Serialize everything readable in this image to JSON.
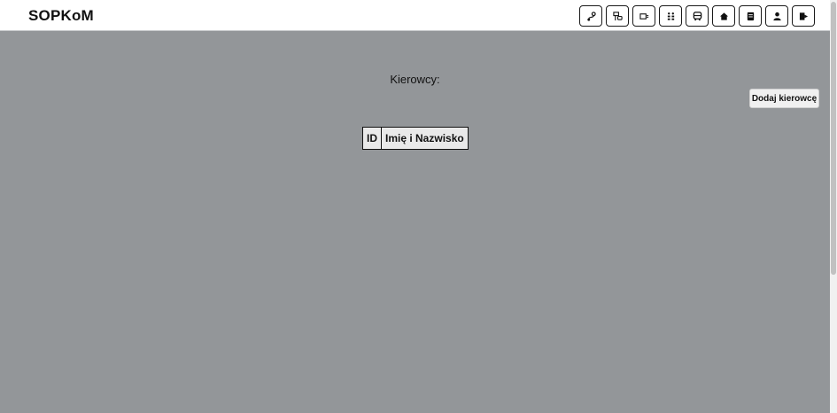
{
  "app": {
    "brand": "SOPKoM"
  },
  "nav": {
    "buttons": [
      {
        "icon": "route-icon"
      },
      {
        "icon": "bus-stop-sign-icon"
      },
      {
        "icon": "vehicle-icon"
      },
      {
        "icon": "users-schedule-icon"
      },
      {
        "icon": "bus-icon"
      },
      {
        "icon": "home-icon"
      },
      {
        "icon": "document-icon"
      },
      {
        "icon": "user-icon"
      },
      {
        "icon": "logout-icon"
      }
    ]
  },
  "main": {
    "heading": "Kierowcy:",
    "add_button_label": "Dodaj kierowcę",
    "table": {
      "headers": [
        "ID",
        "Imię i Nazwisko"
      ],
      "rows": []
    }
  },
  "colors": {
    "background": "#939699",
    "navbar": "#ffffff",
    "table_header_bg": "#e9e9e9"
  }
}
